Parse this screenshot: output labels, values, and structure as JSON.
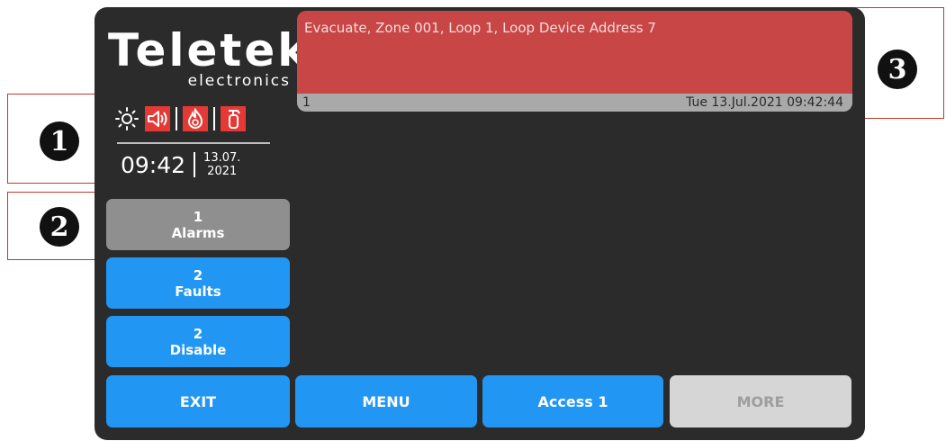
{
  "logo": {
    "main": "Teletek",
    "sub": "electronics"
  },
  "status_icons": [
    "sun-icon",
    "speaker-icon",
    "fire-icon",
    "extinguisher-icon"
  ],
  "clock": {
    "time": "09:42",
    "date_line1": "13.07.",
    "date_line2": "2021"
  },
  "left_buttons": [
    {
      "count": "1",
      "label": "Alarms",
      "state": "active"
    },
    {
      "count": "2",
      "label": "Faults",
      "state": "normal"
    },
    {
      "count": "2",
      "label": "Disable",
      "state": "normal"
    }
  ],
  "bottom_buttons": [
    {
      "label": "EXIT",
      "enabled": true
    },
    {
      "label": "MENU",
      "enabled": true
    },
    {
      "label": "Access 1",
      "enabled": true
    },
    {
      "label": "MORE",
      "enabled": false
    }
  ],
  "alarm": {
    "message": "Evacuate, Zone 001, Loop 1, Loop Device Address 7",
    "index": "1",
    "timestamp": "Tue 13.Jul.2021 09:42:44"
  },
  "callouts": [
    "1",
    "2",
    "3"
  ],
  "colors": {
    "panel": "#2b2b2b",
    "alarm_red": "#c94646",
    "button_blue": "#2196f3",
    "button_gray": "#8f8f8f",
    "icon_red": "#e53935",
    "callout_red": "#c0392b"
  }
}
